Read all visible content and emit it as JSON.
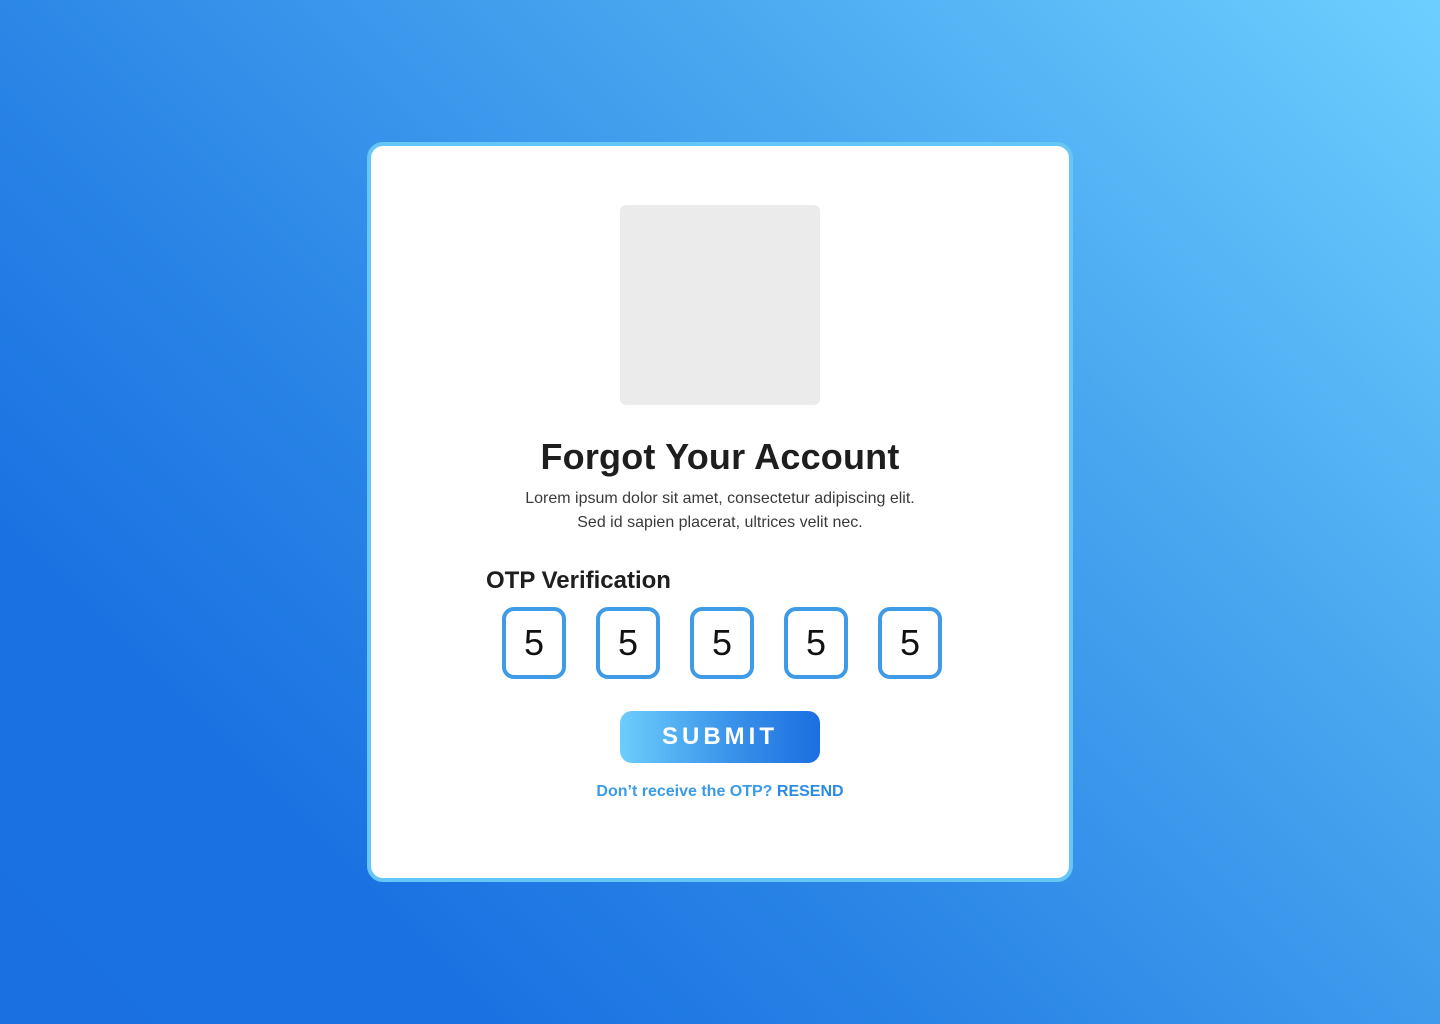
{
  "card": {
    "title": "Forgot Your Account",
    "subtitle_line1": "Lorem ipsum dolor sit amet, consectetur adipiscing elit.",
    "subtitle_line2": "Sed id sapien placerat, ultrices velit nec."
  },
  "otp": {
    "label": "OTP Verification",
    "digits": [
      "5",
      "5",
      "5",
      "5",
      "5"
    ]
  },
  "submit": {
    "label": "SUBMIT"
  },
  "resend": {
    "prompt": "Don’t receive the OTP?",
    "link_label": "RESEND"
  },
  "colors": {
    "accent": "#3f9be6",
    "card_border": "#66c6f5",
    "text_dark": "#1e1e1e"
  }
}
